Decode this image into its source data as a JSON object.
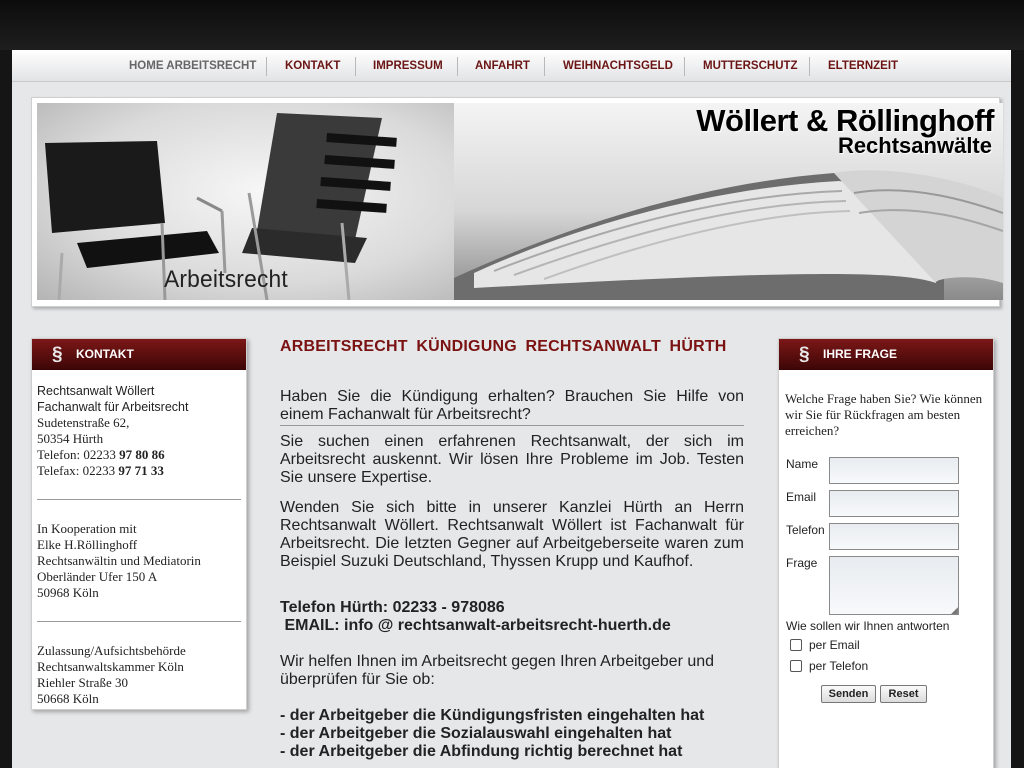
{
  "nav": {
    "items": [
      {
        "label": "HOME ARBEITSRECHT"
      },
      {
        "label": "KONTAKT"
      },
      {
        "label": "IMPRESSUM"
      },
      {
        "label": "ANFAHRT"
      },
      {
        "label": "WEIHNACHTSGELD"
      },
      {
        "label": "MUTTERSCHUTZ"
      },
      {
        "label": "ELTERNZEIT"
      }
    ]
  },
  "banner": {
    "caption": "Arbeitsrecht",
    "firm_name": "Wöllert & Röllinghoff",
    "firm_subtitle": "Rechtsanwälte"
  },
  "contact_box": {
    "title": "KONTAKT",
    "icon": "paragraph-icon",
    "block1": {
      "line1": "Rechtsanwalt Wöllert",
      "line2": "Fachanwalt für Arbeitsrecht",
      "line3": "Sudetenstraße 62,",
      "line4": "50354 Hürth",
      "phone_label": "Telefon: 02233",
      "phone_number": "97 80 86",
      "fax_label": "Telefax: 02233",
      "fax_number": "97 71 33"
    },
    "block2": {
      "line1": "In Kooperation mit",
      "line2": "Elke H.Röllinghoff",
      "line3": "Rechtsanwältin und Mediatorin",
      "line4": "Oberländer Ufer 150 A",
      "line5": "50968 Köln"
    },
    "block3": {
      "line1": "Zulassung/Aufsichtsbehörde",
      "line2": "Rechtsanwaltskammer Köln",
      "line3": "Riehler Straße 30",
      "line4": "50668 Köln"
    }
  },
  "main": {
    "heading": "ARBEITSRECHT KÜNDIGUNG RECHTSANWALT HÜRTH",
    "intro": "Haben Sie die Kündigung erhalten? Brauchen Sie Hilfe von einem Fachanwalt für Arbeitsrecht?",
    "para1": "Sie suchen einen erfahrenen Rechtsanwalt, der sich im Arbeitsrecht auskennt. Wir lösen Ihre Probleme im Job. Testen Sie unsere Expertise.",
    "para2": "Wenden Sie sich bitte in unserer Kanzlei Hürth an Herrn Rechtsanwalt Wöllert. Rechtsanwalt Wöllert ist Fachanwalt für Arbeitsrecht. Die letzten Gegner auf Arbeitgeberseite waren zum Beispiel Suzuki Deutschland, Thyssen Krupp und Kaufhof.",
    "phone_line": "Telefon Hürth: 02233 - 978086",
    "email_line": " EMAIL: info @ rechtsanwalt-arbeitsrecht-huerth.de",
    "para3": "Wir helfen Ihnen im Arbeitsrecht gegen Ihren Arbeitgeber und überprüfen für Sie ob:",
    "checklist": [
      "- der Arbeitgeber die Kündigungsfristen eingehalten hat",
      "- der Arbeitgeber die Sozialauswahl eingehalten hat",
      "- der Arbeitgeber die Abfindung richtig berechnet hat"
    ]
  },
  "question_box": {
    "title": "IHRE FRAGE",
    "icon": "paragraph-icon",
    "intro": "Welche Frage haben Sie? Wie können wir Sie für Rückfragen am besten erreichen?",
    "fields": {
      "name_label": "Name",
      "name_value": "",
      "email_label": "Email",
      "email_value": "",
      "phone_label": "Telefon",
      "phone_value": "",
      "question_label": "Frage",
      "question_value": ""
    },
    "answer_prompt": "Wie sollen wir Ihnen antworten",
    "options": [
      {
        "label": "per Email",
        "checked": false
      },
      {
        "label": "per Telefon",
        "checked": false
      }
    ],
    "send_label": "Senden",
    "reset_label": "Reset"
  },
  "colors": {
    "accent": "#7a1212",
    "header_gradient_top": "#7c1717",
    "header_gradient_bottom": "#3c0606",
    "page_bg": "#e6e7e9"
  }
}
